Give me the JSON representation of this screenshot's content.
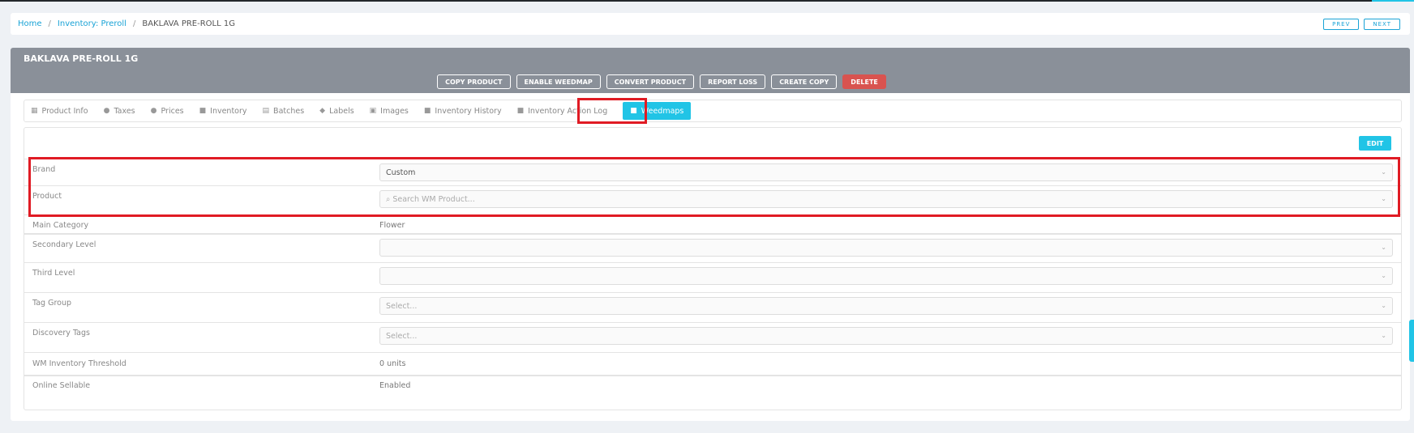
{
  "breadcrumb": {
    "home": "Home",
    "section": "Inventory: Preroll",
    "current": "BAKLAVA PRE-ROLL 1G"
  },
  "nav": {
    "prev": "PREV",
    "next": "NEXT"
  },
  "product": {
    "title": "BAKLAVA PRE-ROLL 1G"
  },
  "actions": {
    "copy": "COPY PRODUCT",
    "enable_weedmap": "ENABLE WEEDMAP",
    "convert": "CONVERT PRODUCT",
    "report_loss": "REPORT LOSS",
    "create_copy": "CREATE COPY",
    "delete": "DELETE"
  },
  "tabs": [
    {
      "label": "Product Info",
      "icon": "calendar-icon"
    },
    {
      "label": "Taxes",
      "icon": "money-bag-icon"
    },
    {
      "label": "Prices",
      "icon": "money-bag-icon"
    },
    {
      "label": "Inventory",
      "icon": "lock-icon"
    },
    {
      "label": "Batches",
      "icon": "batches-icon"
    },
    {
      "label": "Labels",
      "icon": "tag-icon"
    },
    {
      "label": "Images",
      "icon": "image-icon"
    },
    {
      "label": "Inventory History",
      "icon": "lock-icon"
    },
    {
      "label": "Inventory Action Log",
      "icon": "lock-icon"
    },
    {
      "label": "Weedmaps",
      "icon": "lock-icon",
      "active": true
    }
  ],
  "panel": {
    "edit": "EDIT",
    "fields": {
      "brand": {
        "label": "Brand",
        "value": "Custom"
      },
      "product": {
        "label": "Product",
        "placeholder": "Search WM Product..."
      },
      "main_category": {
        "label": "Main Category",
        "value": "Flower"
      },
      "secondary_level": {
        "label": "Secondary Level",
        "value": ""
      },
      "third_level": {
        "label": "Third Level",
        "value": ""
      },
      "tag_group": {
        "label": "Tag Group",
        "placeholder": "Select..."
      },
      "discovery_tags": {
        "label": "Discovery Tags",
        "placeholder": "Select..."
      },
      "threshold": {
        "label": "WM Inventory Threshold",
        "value": "0 units"
      },
      "online_sellable": {
        "label": "Online Sellable",
        "value": "Enabled"
      }
    }
  },
  "colors": {
    "accent": "#21c4e6",
    "header": "#8a9099",
    "danger": "#d9534f",
    "highlight": "#e01b24"
  }
}
